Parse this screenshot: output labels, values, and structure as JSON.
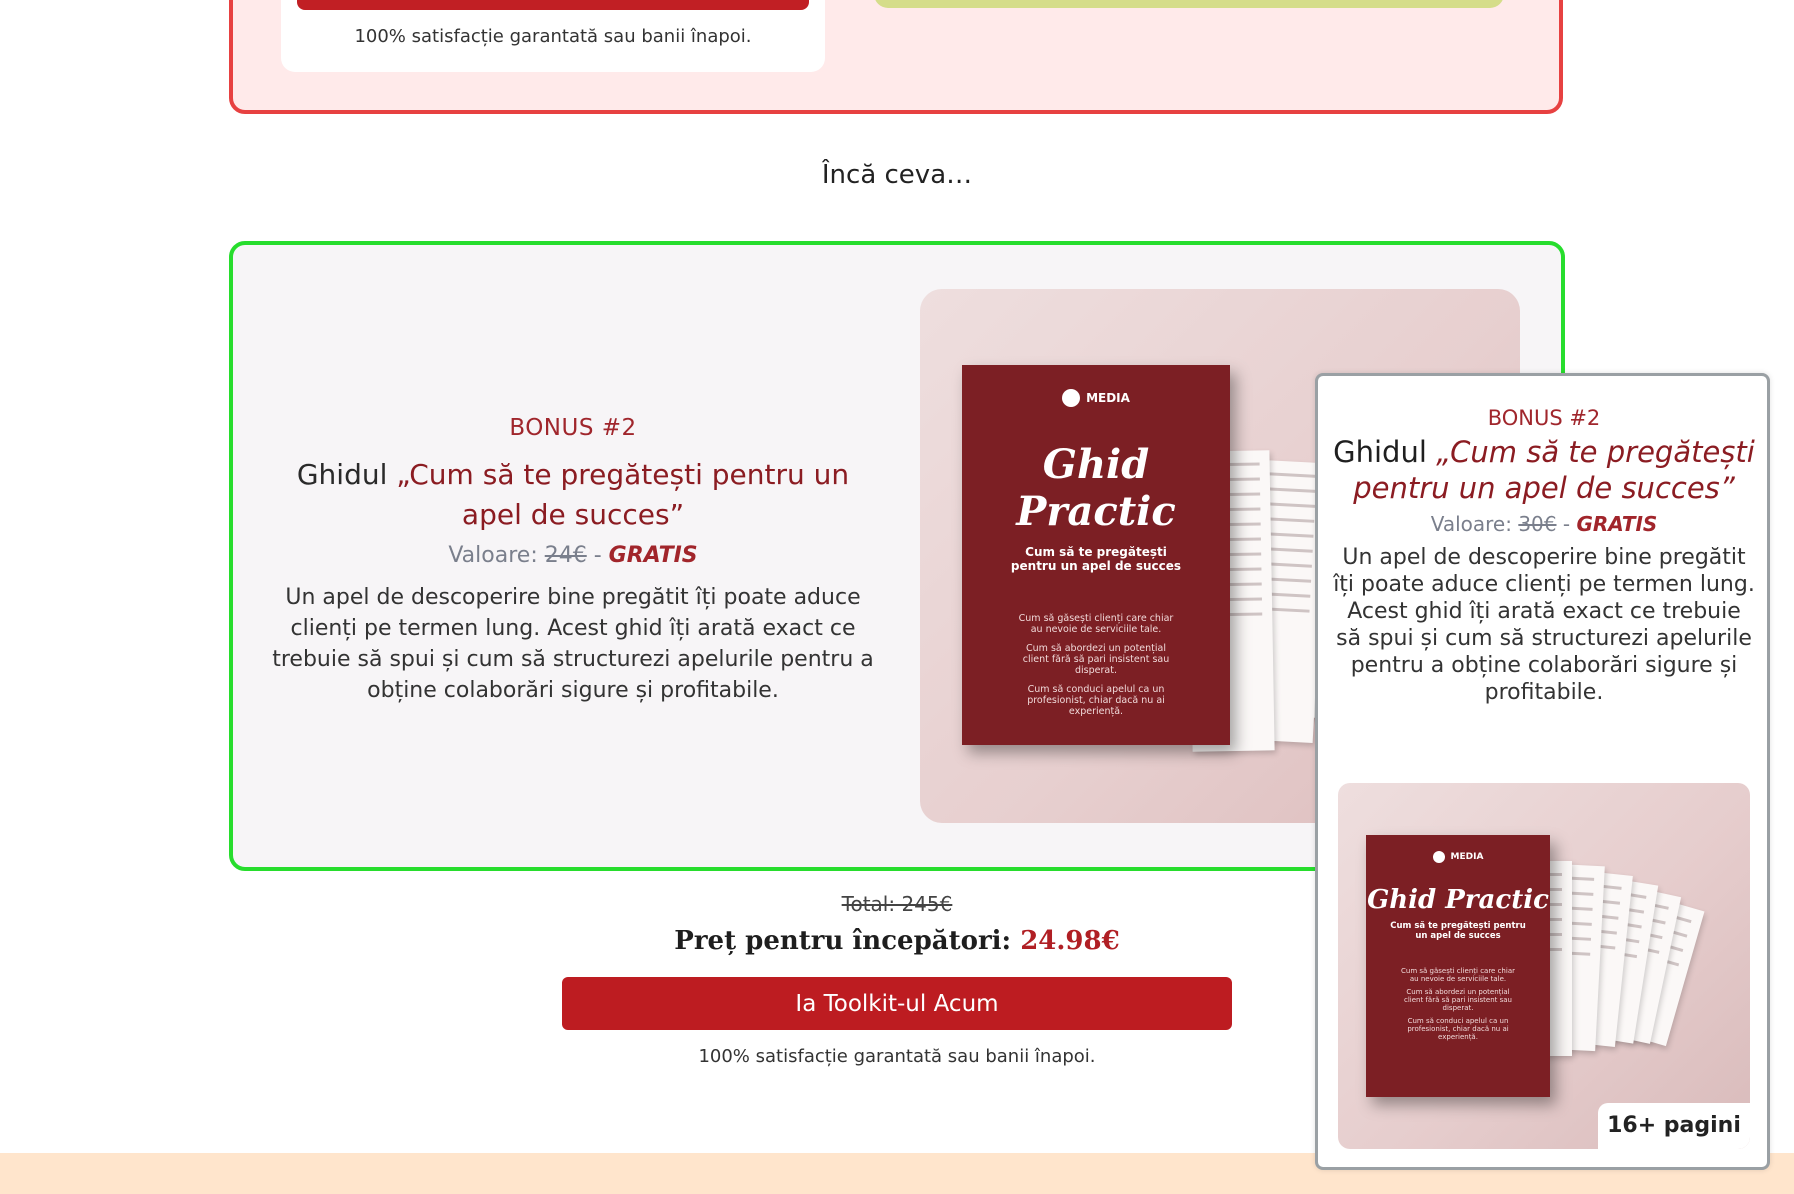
{
  "top_card": {
    "guarantee": "100% satisfacție garantată sau banii înapoi."
  },
  "section_intro": "Încă ceva…",
  "bonus": {
    "label": "BONUS #2",
    "title_prefix": "Ghidul ",
    "title_emphasis": "„Cum să te pregătești pentru un apel de succes”",
    "value_label": "Valoare:",
    "old_price": "24€",
    "separator": " - ",
    "free_label": "GRATIS",
    "description": "Un apel de descoperire bine pregătit îți poate aduce clienți pe termen lung. Acest ghid îți arată exact ce trebuie să spui și cum să structurezi apelurile pentru a obține colaborări sigure și profitabile."
  },
  "mockup": {
    "brand": "MEDIA",
    "cover_title": "Ghid Practic",
    "cover_subtitle": "Cum să te pregătești pentru un apel de succes",
    "cover_points": [
      "Cum să găsești clienți care chiar au nevoie de serviciile tale.",
      "Cum să abordezi un potențial client fără să pari insistent sau disperat.",
      "Cum să conduci apelul ca un profesionist, chiar dacă nu ai experiență."
    ]
  },
  "pricing": {
    "total_old": "Total: 245€",
    "price_label": "Preț pentru începători:",
    "price_value": "24.98€",
    "cta_label": "Ia Toolkit-ul Acum",
    "guarantee": "100% satisfacție garantată sau banii înapoi."
  },
  "float_card": {
    "label": "BONUS #2",
    "title_prefix": "Ghidul ",
    "title_emphasis": "„Cum să te pregătești pentru un apel de succes”",
    "value_label": "Valoare:",
    "old_price": "30€",
    "separator": " - ",
    "free_label": "GRATIS",
    "description": "Un apel de descoperire bine pregătit îți poate aduce clienți pe termen lung. Acest ghid îți arată exact ce trebuie să spui și cum să structurezi apelurile pentru a obține colaborări sigure și profitabile.",
    "pages_badge": "16+ pagini"
  },
  "colors": {
    "accent_red": "#bd1c21",
    "card_border_red": "#e74141",
    "card_border_green": "#27dd2d",
    "footer_band": "#ffe5cc"
  }
}
